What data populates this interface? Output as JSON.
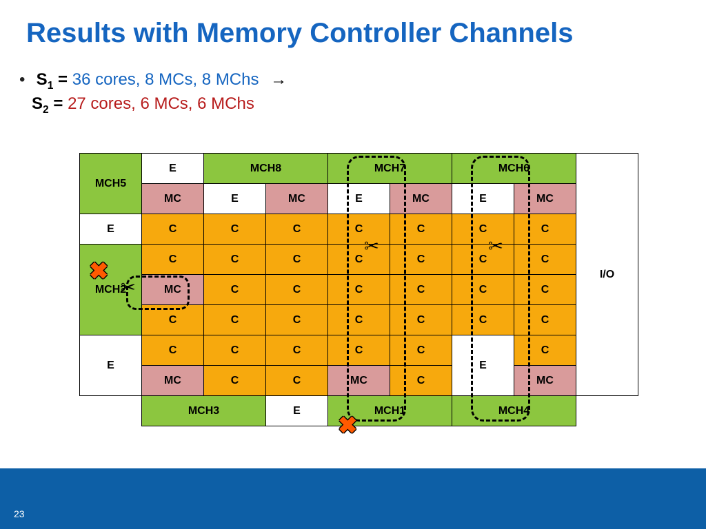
{
  "title": "Results with Memory Controller Channels",
  "s1": {
    "label": "S",
    "sub": "1",
    "eq": " = ",
    "value": "36 cores, 8 MCs, 8 MChs"
  },
  "s2": {
    "label": "S",
    "sub": "2",
    "eq": " = ",
    "value": "27 cores, 6 MCs, 6 MChs"
  },
  "arrow": "→",
  "pagenum": "23",
  "labels": {
    "MCH1": "MCH1",
    "MCH2": "MCH2",
    "MCH3": "MCH3",
    "MCH4": "MCH4",
    "MCH5": "MCH5",
    "MCH6": "MCH6",
    "MCH7": "MCH7",
    "MCH8": "MCH8",
    "E": "E",
    "MC": "MC",
    "C": "C",
    "IO": "I/O"
  },
  "icons": {
    "cross": "✖",
    "scissor": "✂"
  }
}
